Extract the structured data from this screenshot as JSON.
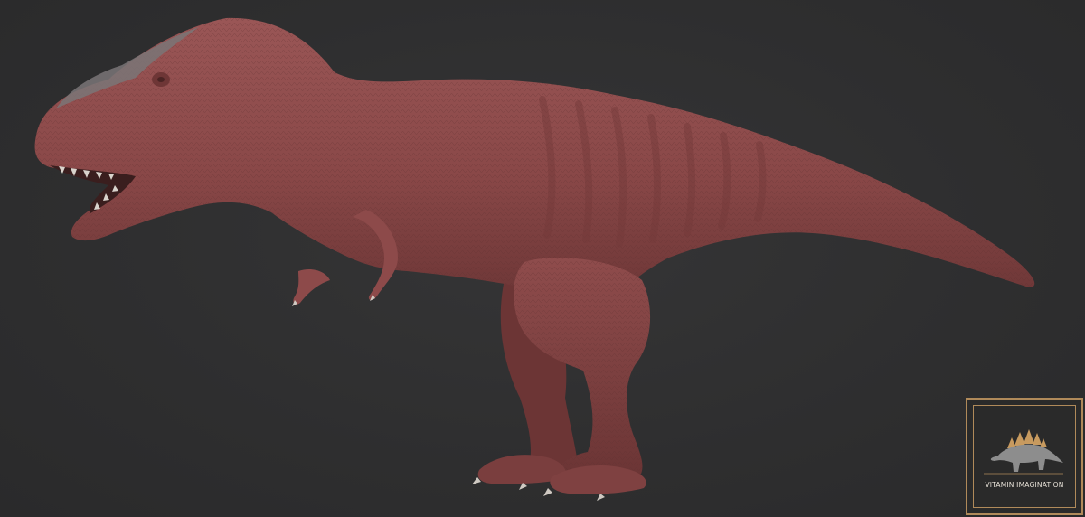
{
  "scene": {
    "background_color": "#2f2f30",
    "subject": "dinosaur-sculpt",
    "subject_color": "#8e4b4b"
  },
  "logo": {
    "text": "VITAMIN IMAGINATION",
    "frame_color": "#b08a5a",
    "mark_icon": "stegosaurus-icon"
  }
}
